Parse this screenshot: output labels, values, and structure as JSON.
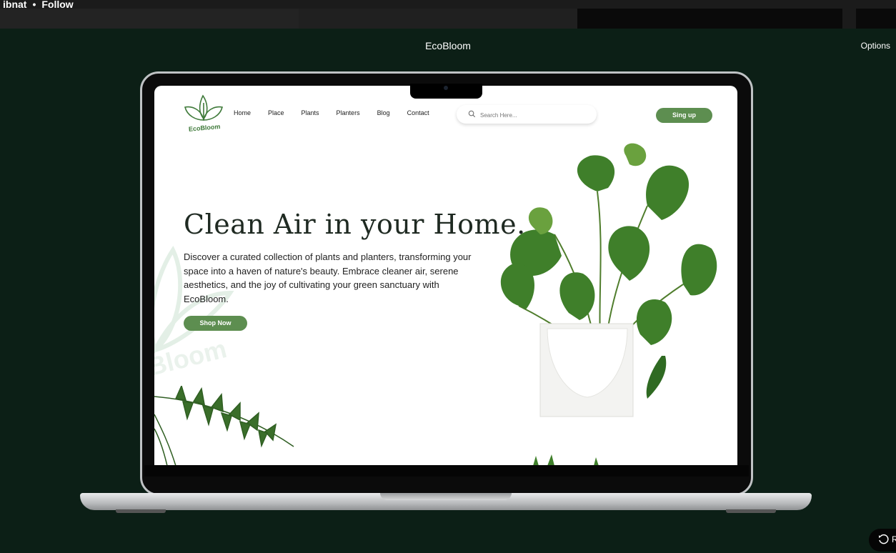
{
  "viewer": {
    "author": "ibnat",
    "separator": "•",
    "follow_label": "Follow",
    "shot_title": "EcoBloom",
    "options_label": "Options",
    "restart_label": "R"
  },
  "site": {
    "logo_text": "EcoBloom",
    "nav": [
      "Home",
      "Place",
      "Plants",
      "Planters",
      "Blog",
      "Contact"
    ],
    "search_placeholder": "Search Here...",
    "signup_label": "Sing up",
    "hero_title": "Clean Air in your Home.",
    "hero_description": "Discover a curated collection of plants and planters, transforming your space into a haven of nature's beauty. Embrace cleaner air, serene aesthetics, and the joy of cultivating your green sanctuary with EcoBloom.",
    "shop_label": "Shop Now",
    "watermark_text": "Bloom"
  },
  "colors": {
    "page_bg": "#0c1f16",
    "brand_green": "#5d8e50",
    "heading": "#1f2a22"
  }
}
